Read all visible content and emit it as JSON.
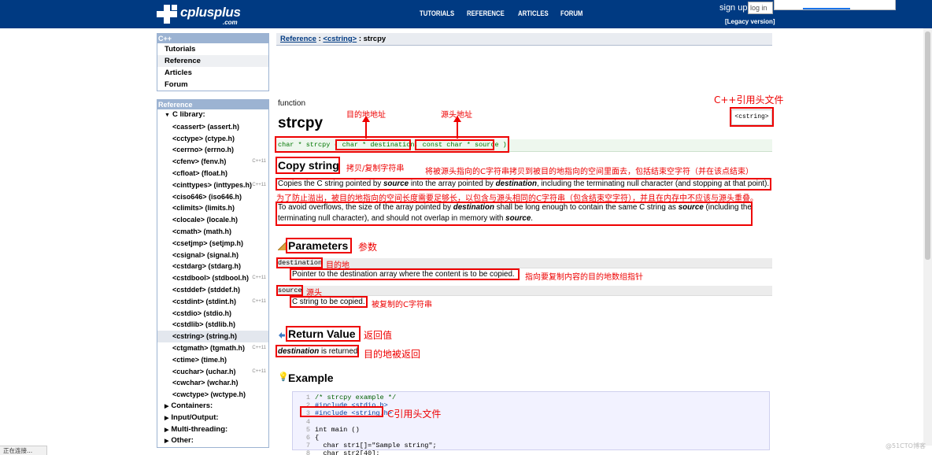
{
  "logo": {
    "name": "cplusplus",
    "suffix": ".com"
  },
  "topnav": [
    "TUTORIALS",
    "REFERENCE",
    "ARTICLES",
    "FORUM"
  ],
  "signin": {
    "label": "sign up",
    "login_placeholder": "log in",
    "legacy": "[Legacy version]"
  },
  "sidebar": {
    "cpp_head": "C++",
    "cpp_items": [
      "Tutorials",
      "Reference",
      "Articles",
      "Forum"
    ],
    "ref_head": "Reference",
    "clib_label": "C library:",
    "libs": [
      {
        "label": "<cassert> (assert.h)",
        "ver": ""
      },
      {
        "label": "<cctype> (ctype.h)",
        "ver": ""
      },
      {
        "label": "<cerrno> (errno.h)",
        "ver": ""
      },
      {
        "label": "<cfenv> (fenv.h)",
        "ver": "C++11"
      },
      {
        "label": "<cfloat> (float.h)",
        "ver": ""
      },
      {
        "label": "<cinttypes> (inttypes.h)",
        "ver": "C++11"
      },
      {
        "label": "<ciso646> (iso646.h)",
        "ver": ""
      },
      {
        "label": "<climits> (limits.h)",
        "ver": ""
      },
      {
        "label": "<clocale> (locale.h)",
        "ver": ""
      },
      {
        "label": "<cmath> (math.h)",
        "ver": ""
      },
      {
        "label": "<csetjmp> (setjmp.h)",
        "ver": ""
      },
      {
        "label": "<csignal> (signal.h)",
        "ver": ""
      },
      {
        "label": "<cstdarg> (stdarg.h)",
        "ver": ""
      },
      {
        "label": "<cstdbool> (stdbool.h)",
        "ver": "C++11"
      },
      {
        "label": "<cstddef> (stddef.h)",
        "ver": ""
      },
      {
        "label": "<cstdint> (stdint.h)",
        "ver": "C++11"
      },
      {
        "label": "<cstdio> (stdio.h)",
        "ver": ""
      },
      {
        "label": "<cstdlib> (stdlib.h)",
        "ver": ""
      },
      {
        "label": "<cstring> (string.h)",
        "ver": ""
      },
      {
        "label": "<ctgmath> (tgmath.h)",
        "ver": "C++11"
      },
      {
        "label": "<ctime> (time.h)",
        "ver": ""
      },
      {
        "label": "<cuchar> (uchar.h)",
        "ver": "C++11"
      },
      {
        "label": "<cwchar> (wchar.h)",
        "ver": ""
      },
      {
        "label": "<cwctype> (wctype.h)",
        "ver": ""
      }
    ],
    "groups": [
      "Containers:",
      "Input/Output:",
      "Multi-threading:",
      "Other:"
    ]
  },
  "breadcrumb": {
    "ref": "Reference",
    "sep1": " : ",
    "lib": "<cstring>",
    "sep2": " : ",
    "current": "strcpy"
  },
  "func": {
    "kind": "function",
    "name": "strcpy",
    "header": "<cstring>",
    "proto_pre": "char * strcpy ( ",
    "proto_dest": "char * destination",
    "proto_comma": ", ",
    "proto_src": "const char * source",
    "proto_post": " );"
  },
  "copy_title": "Copy string",
  "desc1": {
    "a": "Copies the C string pointed by ",
    "b": "source",
    "c": " into the array pointed by ",
    "d": "destination",
    "e": ", including the terminating null character (and stopping at that point)."
  },
  "desc2": {
    "a": "To avoid overflows, the size of the array pointed by ",
    "b": "destination",
    "c": " shall be long enough to contain the same C string as ",
    "d": "source",
    "e": " (including the terminating null character), and should not overlap in memory with ",
    "f": "source",
    "g": "."
  },
  "params_title": "Parameters",
  "param_dest": {
    "name": "destination",
    "desc": "Pointer to the destination array where the content is to be copied."
  },
  "param_src": {
    "name": "source",
    "desc": "C string to be copied."
  },
  "return_title": "Return Value",
  "return_text": {
    "a": "destination",
    "b": " is returned."
  },
  "example_title": "Example",
  "code": [
    {
      "n": "1",
      "t": "/* strcpy example */"
    },
    {
      "n": "2",
      "t": "#include <stdio.h>"
    },
    {
      "n": "3",
      "t": "#include <string.h>"
    },
    {
      "n": "4",
      "t": ""
    },
    {
      "n": "5",
      "t": "int main ()"
    },
    {
      "n": "6",
      "t": "{"
    },
    {
      "n": "7",
      "t": "  char str1[]=\"Sample string\";"
    },
    {
      "n": "8",
      "t": "  char str2[40];"
    }
  ],
  "annotations": {
    "dest_addr": "目的地地址",
    "src_addr": "源头地址",
    "cpp_header": "C++引用头文件",
    "copy": "拷贝/复制字符串",
    "copy_desc": "将被源头指向的C字符串拷贝到被目的地指向的空间里面去，包括结束空字符（并在该点结束）",
    "overflow": "为了防止溢出，被目的地指向的空间长度需要足够长，以包含与源头相同的C字符串（包含结束空字符），并且在内存中不应该与源头重叠。",
    "params": "参数",
    "dest": "目的地",
    "dest_desc": "指向要复制内容的目的地数组指针",
    "src": "源头",
    "src_desc": "被复制的C字符串",
    "return": "返回值",
    "returned": "目的地被返回",
    "c_header": "C引用头文件"
  },
  "status": "正在连接...",
  "watermark": "@51CTO博客"
}
